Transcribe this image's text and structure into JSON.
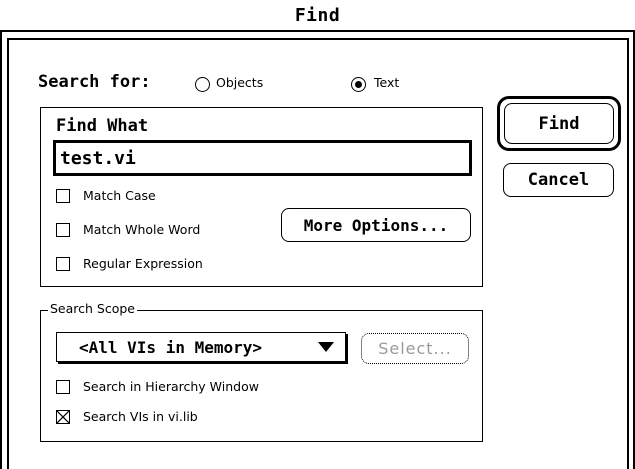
{
  "window": {
    "title": "Find"
  },
  "search_for": {
    "label": "Search for:",
    "options": [
      {
        "label": "Objects",
        "selected": false
      },
      {
        "label": "Text",
        "selected": true
      }
    ]
  },
  "find_what": {
    "label": "Find What",
    "value": "test.vi",
    "checkboxes": [
      {
        "label": "Match Case",
        "checked": false
      },
      {
        "label": "Match Whole Word",
        "checked": false
      },
      {
        "label": "Regular Expression",
        "checked": false
      }
    ],
    "more_options_label": "More Options..."
  },
  "buttons": {
    "find": "Find",
    "cancel": "Cancel"
  },
  "search_scope": {
    "legend": "Search Scope",
    "selected_scope": "<All VIs in Memory>",
    "select_button": "Select...",
    "checkboxes": [
      {
        "label": "Search in Hierarchy Window",
        "checked": false
      },
      {
        "label": "Search VIs in vi.lib",
        "checked": true
      }
    ]
  },
  "icons": {
    "dropdown_arrow": "triangle-down-icon",
    "checkbox_checked": "x-mark-icon",
    "radio_selected": "radio-dot-icon"
  },
  "colors": {
    "foreground": "#000000",
    "background": "#ffffff",
    "disabled_text": "#9a9a9a"
  }
}
